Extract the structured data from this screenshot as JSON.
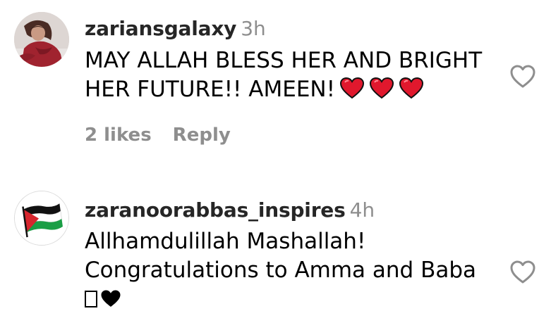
{
  "comments": [
    {
      "username": "zariansgalaxy",
      "time": "3h",
      "text_line1": "MAY ALLAH BLESS HER AND BRIGHT",
      "text_line2": "HER FUTURE!! AMEEN!",
      "emojis": [
        "red-heart",
        "red-heart",
        "red-heart"
      ],
      "likes": "2 likes",
      "reply": "Reply",
      "avatar": "user-photo"
    },
    {
      "username": "zaranoorabbas_inspires",
      "time": "4h",
      "text_line1": "Allhamdulillah Mashallah!",
      "text_line2": "Congratulations to Amma and Baba",
      "emojis": [
        "missing-glyph",
        "black-heart"
      ],
      "avatar": "palestine-flag"
    }
  ],
  "colors": {
    "username": "#262626",
    "meta": "#8e8e8e",
    "heart_red": "#e0182d"
  },
  "icons": {
    "like": "heart-outline-icon"
  }
}
